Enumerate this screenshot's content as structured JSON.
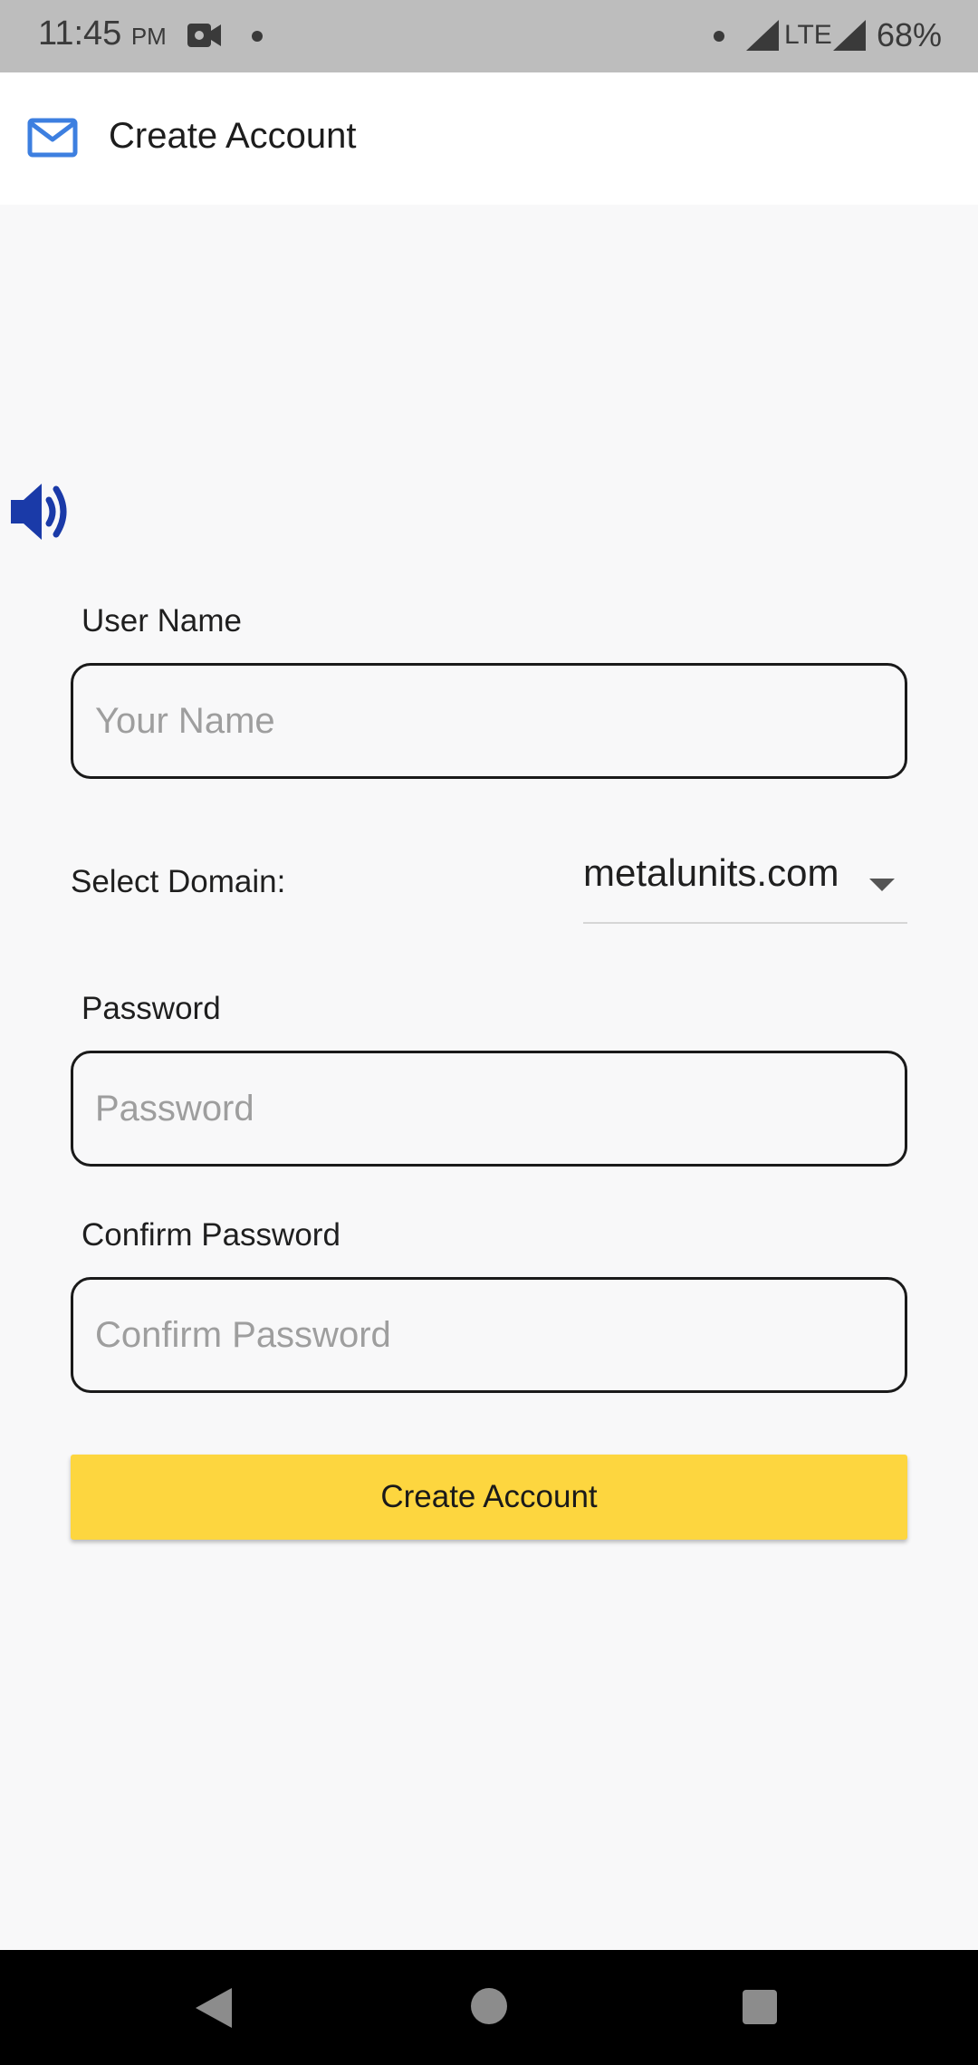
{
  "status_bar": {
    "time": "11:45",
    "ampm": "PM",
    "network": "LTE",
    "battery": "68%"
  },
  "app_bar": {
    "title": "Create Account",
    "icon": "mail-icon"
  },
  "form": {
    "username": {
      "label": "User Name",
      "placeholder": "Your Name",
      "value": ""
    },
    "domain": {
      "label": "Select Domain:",
      "selected": "metalunits.com"
    },
    "password": {
      "label": "Password",
      "placeholder": "Password",
      "value": ""
    },
    "confirm_password": {
      "label": "Confirm Password",
      "placeholder": "Confirm Password",
      "value": ""
    },
    "submit_label": "Create Account"
  },
  "colors": {
    "accent_button": "#fdd63f",
    "speaker_icon": "#1a3aa8",
    "mail_icon": "#3d7fe0"
  }
}
